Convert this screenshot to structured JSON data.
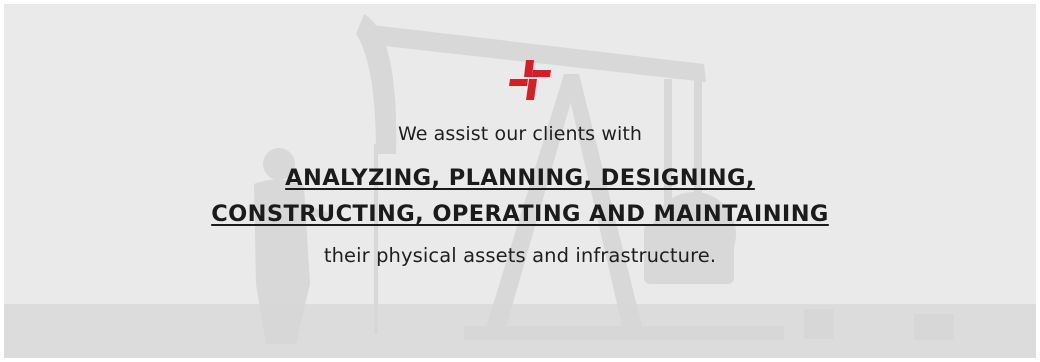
{
  "banner": {
    "intro_text": "We assist our clients with",
    "highlight_line_1": "ANALYZING, PLANNING, DESIGNING,",
    "highlight_line_2": "CONSTRUCTING, OPERATING AND MAINTAINING",
    "outro_text": "their physical assets and infrastructure.",
    "logo_icon": "red-cross-brand-logo",
    "background_scene": "oil-pumpjack-silhouette-with-worker",
    "colors": {
      "logo_red": "#d32027",
      "text": "#1f1f1f",
      "background": "#ebebeb"
    }
  }
}
